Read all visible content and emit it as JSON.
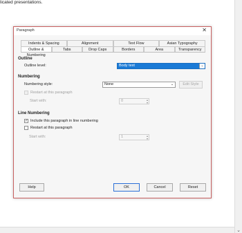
{
  "background": {
    "text": "licated presentations."
  },
  "dialog": {
    "title": "Paragraph",
    "close_glyph": "✕",
    "tabs_row1": [
      "Indents & Spacing",
      "Alignment",
      "Text Flow",
      "Asian Typography"
    ],
    "tabs_row2": [
      "Outline & Numbering",
      "Tabs",
      "Drop Caps",
      "Borders",
      "Area",
      "Transparency"
    ],
    "active_tab": "Outline & Numbering",
    "outline": {
      "section": "Outline",
      "level_label": "Outline level:",
      "level_value": "Body text"
    },
    "numbering": {
      "section": "Numbering",
      "style_label": "Numbering style:",
      "style_value": "None",
      "edit_style_button": "Edit Style",
      "restart_label": "Restart at this paragraph",
      "start_with_label": "Start with:",
      "start_with_value": "0"
    },
    "line_numbering": {
      "section": "Line Numbering",
      "include_label": "Include this paragraph in line numbering",
      "include_checked": true,
      "restart_label": "Restart at this paragraph",
      "restart_checked": false,
      "start_with_label": "Start with:",
      "start_with_value": "1"
    },
    "buttons": {
      "help": "Help",
      "ok": "OK",
      "cancel": "Cancel",
      "reset": "Reset"
    }
  },
  "colors": {
    "selection": "#1a7ad6",
    "dialog_border": "#c86060"
  }
}
